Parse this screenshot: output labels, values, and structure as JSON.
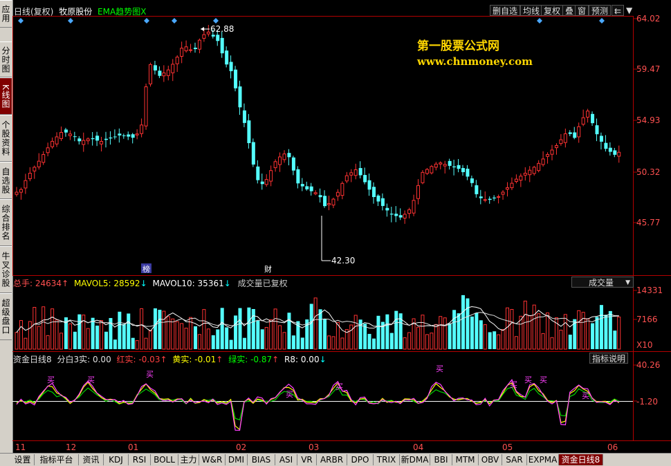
{
  "sidebar_tabs": [
    {
      "label": "应用"
    },
    {
      "label": "分时图"
    },
    {
      "label": "K线图"
    },
    {
      "label": "个股资料"
    },
    {
      "label": "自选股"
    },
    {
      "label": "综合排名"
    },
    {
      "label": "牛叉诊股"
    },
    {
      "label": "超级盘口"
    }
  ],
  "header": {
    "period_label": "日线(复权)",
    "stock_name": "牧原股份",
    "indicator_name": "EMA趋势图X"
  },
  "toolbar": {
    "buttons": [
      "删自选",
      "均线",
      "复权",
      "叠",
      "窗",
      "预测"
    ],
    "arrow_left": "⇇",
    "arrow_down": "▼"
  },
  "watermark": {
    "title": "第一股票公式网",
    "url": "www.chnmoney.com"
  },
  "price_axis": [
    "64.02",
    "59.47",
    "54.93",
    "50.32",
    "45.77"
  ],
  "annotations": {
    "high": "62.88",
    "low": "42.30",
    "marker_1": "榜",
    "marker_2": "财"
  },
  "volume_panel": {
    "total_label": "总手:",
    "total_value": "24634",
    "mavol5_label": "MAVOL5:",
    "mavol5_value": "28592",
    "mavol10_label": "MAVOL10:",
    "mavol10_value": "35361",
    "note": "成交量已复权",
    "selector": "成交量",
    "axis": [
      "14331",
      "7166",
      "X10"
    ]
  },
  "indicator_panel": {
    "title": "资金日线8",
    "s1_label": "分白3实:",
    "s1_value": "0.00",
    "s2_label": "红实:",
    "s2_value": "-0.03",
    "s3_label": "黄实:",
    "s3_value": "-0.01",
    "s4_label": "绿实:",
    "s4_value": "-0.87",
    "s5_label": "R8:",
    "s5_value": "0.00",
    "button": "指标说明",
    "axis": [
      "40.26",
      "-1.20"
    ],
    "buy_signal": "买"
  },
  "date_axis": [
    "11",
    "12",
    "01",
    "02",
    "03",
    "04",
    "05",
    "06"
  ],
  "bottom_tabs": [
    "设置",
    "指标平台",
    "资讯",
    "KDJ",
    "RSI",
    "BOLL",
    "主力",
    "W&R",
    "DMI",
    "BIAS",
    "ASI",
    "VR",
    "ARBR",
    "DPO",
    "TRIX",
    "新DMA",
    "BBI",
    "MTM",
    "OBV",
    "SAR",
    "EXPMA",
    "资金日线8"
  ],
  "colors": {
    "up": "#ff3232",
    "down": "#54ffff",
    "axis_red": "#b40000",
    "yellow": "#ffff00",
    "magenta": "#ff40ff",
    "green": "#00d000",
    "white": "#ffffff",
    "watermark": "#ffd700"
  }
}
